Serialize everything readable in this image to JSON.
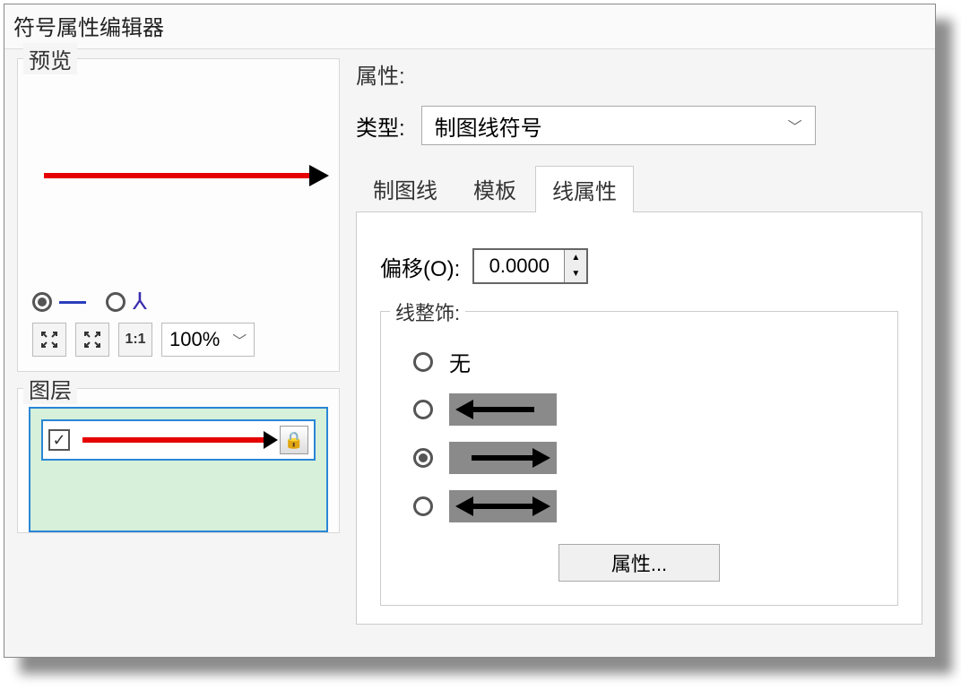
{
  "window": {
    "title": "符号属性编辑器"
  },
  "preview": {
    "label": "预览",
    "style_line_selected": true,
    "zoom": "100%"
  },
  "layers": {
    "label": "图层"
  },
  "properties": {
    "label": "属性:",
    "type_label": "类型:",
    "type_value": "制图线符号"
  },
  "tabs": {
    "t1": "制图线",
    "t2": "模板",
    "t3": "线属性",
    "active": "t3"
  },
  "offset": {
    "label": "偏移(O):",
    "value": "0.0000"
  },
  "decor": {
    "label": "线整饰:",
    "none_label": "无",
    "selected": "right",
    "props_btn": "属性..."
  }
}
